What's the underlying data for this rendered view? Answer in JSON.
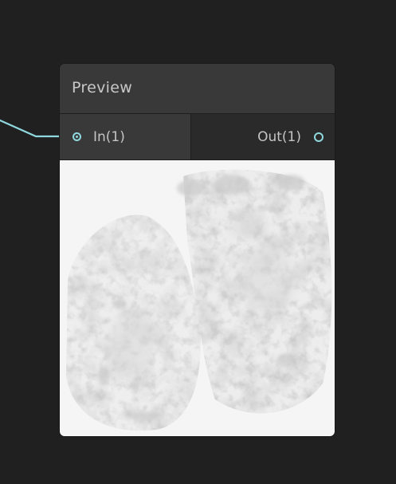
{
  "node": {
    "title": "Preview",
    "input_port": {
      "label": "In(1)",
      "connected": true
    },
    "output_port": {
      "label": "Out(1)",
      "connected": false
    },
    "preview": {
      "description_icon": "texture-preview-image"
    }
  },
  "colors": {
    "canvas_bg": "#202020",
    "node_header": "#393939",
    "port_accent": "#8fd8dd",
    "text": "#c8c8c8"
  }
}
